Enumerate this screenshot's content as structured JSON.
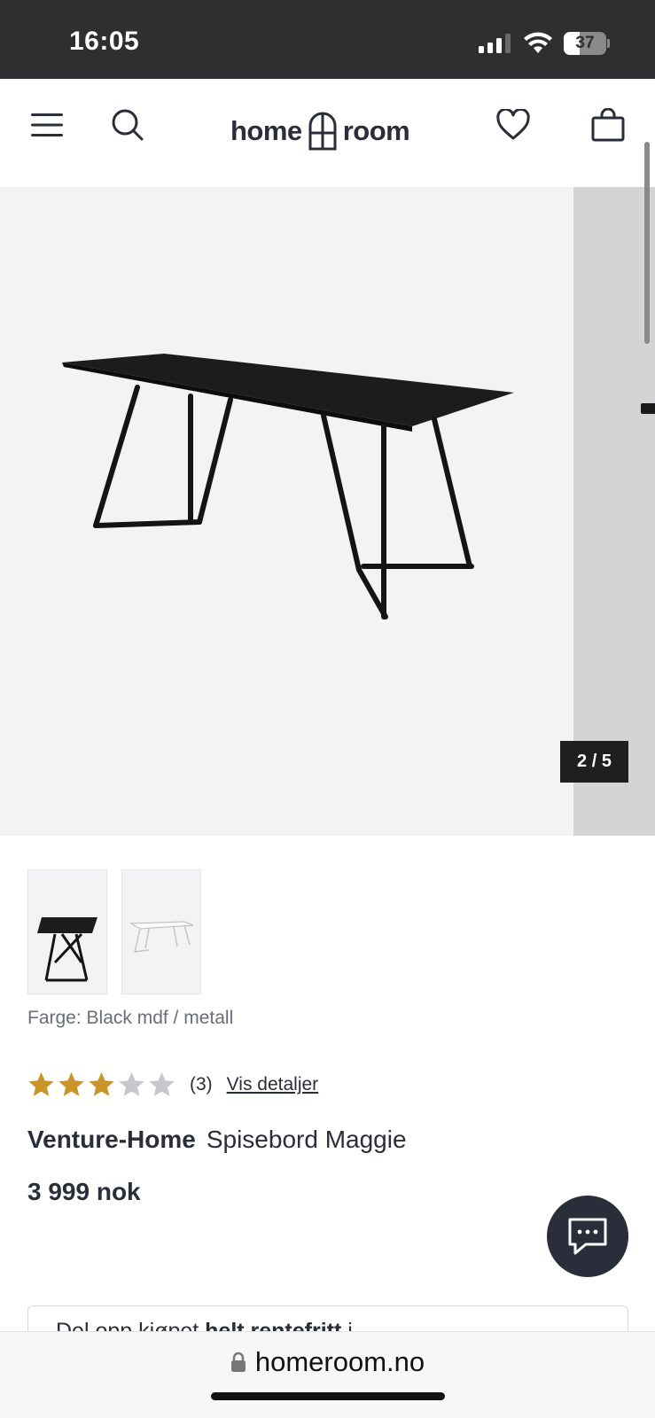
{
  "status_bar": {
    "time": "16:05",
    "battery": "37",
    "battery_level_pct": 37
  },
  "header": {
    "logo_left": "home",
    "logo_right": "room",
    "menu_icon": "hamburger-menu-icon",
    "search_icon": "search-icon",
    "wishlist_icon": "heart-icon",
    "cart_icon": "shopping-bag-icon"
  },
  "gallery": {
    "counter": "2 / 5"
  },
  "product": {
    "color_label": "Farge: Black mdf / metall",
    "rating_value": 3,
    "rating_max": 5,
    "review_count": "(3)",
    "details_link": "Vis detaljer",
    "brand": "Venture-Home",
    "name": "Spisebord Maggie",
    "price": "3 999 nok"
  },
  "finance": {
    "text_plain": "Del opp kjøpet ",
    "text_bold": "helt rentefritt",
    "text_rest": " i"
  },
  "browser": {
    "url": "homeroom.no"
  },
  "colors": {
    "star_filled": "#c9952b",
    "star_empty": "#c8c8cc",
    "dark": "#2a2d3a"
  }
}
